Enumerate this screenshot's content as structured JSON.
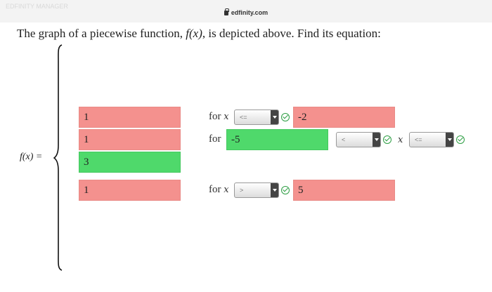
{
  "browser": {
    "top_left_text": "EDFINITY MANAGER",
    "url": "edfinity.com"
  },
  "question": {
    "prefix": "The graph of a piecewise function, ",
    "func": "f(x)",
    "suffix": ", is depicted above. Find its equation:"
  },
  "fx_label": "f(x) =",
  "rows": [
    {
      "value": "1",
      "value_status": "incorrect",
      "for_label": "for x",
      "op": "<=",
      "op_check": "correct",
      "bound": "-2",
      "bound_status": "incorrect"
    },
    {
      "value": "1",
      "value_status": "incorrect",
      "for_label": "for",
      "lower": "-5",
      "lower_status": "correct",
      "op1": "<",
      "op1_check": "correct",
      "x_label": "x",
      "op2": "<=",
      "op2_check": "correct"
    },
    {
      "value": "3",
      "value_status": "correct"
    },
    {
      "value": "1",
      "value_status": "incorrect",
      "for_label": "for x",
      "op": ">",
      "op_check": "correct",
      "bound": "5",
      "bound_status": "incorrect"
    }
  ],
  "colors": {
    "incorrect": "#f4918e",
    "correct": "#4fd96b",
    "check": "#2e9e44"
  }
}
